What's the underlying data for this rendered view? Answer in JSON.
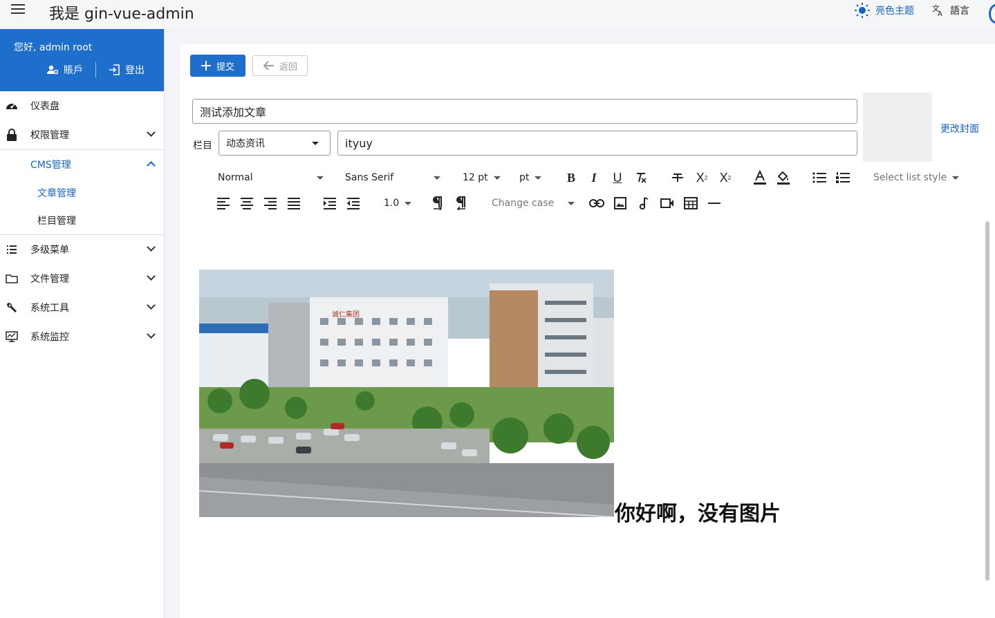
{
  "header": {
    "app_title": "我是 gin-vue-admin",
    "theme_label": "亮色主题",
    "language_label": "語言"
  },
  "user": {
    "greeting": "您好, admin  root",
    "account_label": "賬戶",
    "logout_label": "登出"
  },
  "sidebar": {
    "items": [
      {
        "label": "仪表盘",
        "icon": "dashboard-icon"
      },
      {
        "label": "权限管理",
        "icon": "lock-icon"
      },
      {
        "label": "CMS管理",
        "icon": ""
      },
      {
        "label": "多级菜单",
        "icon": "list-icon"
      },
      {
        "label": "文件管理",
        "icon": "folder-icon"
      },
      {
        "label": "系统工具",
        "icon": "wrench-icon"
      },
      {
        "label": "系统监控",
        "icon": "monitor-icon"
      }
    ],
    "cms_children": [
      {
        "label": "文章管理"
      },
      {
        "label": "栏目管理"
      }
    ]
  },
  "actions": {
    "submit_label": "提交",
    "back_label": "返回"
  },
  "form": {
    "title_value": "测试添加文章",
    "column_label": "栏目",
    "column_value": "动态资讯",
    "subtitle_value": "ityuy",
    "cover_link": "更改封面"
  },
  "toolbar": {
    "format": "Normal",
    "font": "Sans Serif",
    "size": "12 pt",
    "unit": "pt",
    "list_style": "Select list style",
    "line_height": "1.0",
    "change_case": "Change case"
  },
  "editor": {
    "content_text": "你好啊，没有图片",
    "photo_sign": "诚仁集团"
  },
  "colors": {
    "accent": "#1e6fcc",
    "link": "#1565c0"
  }
}
